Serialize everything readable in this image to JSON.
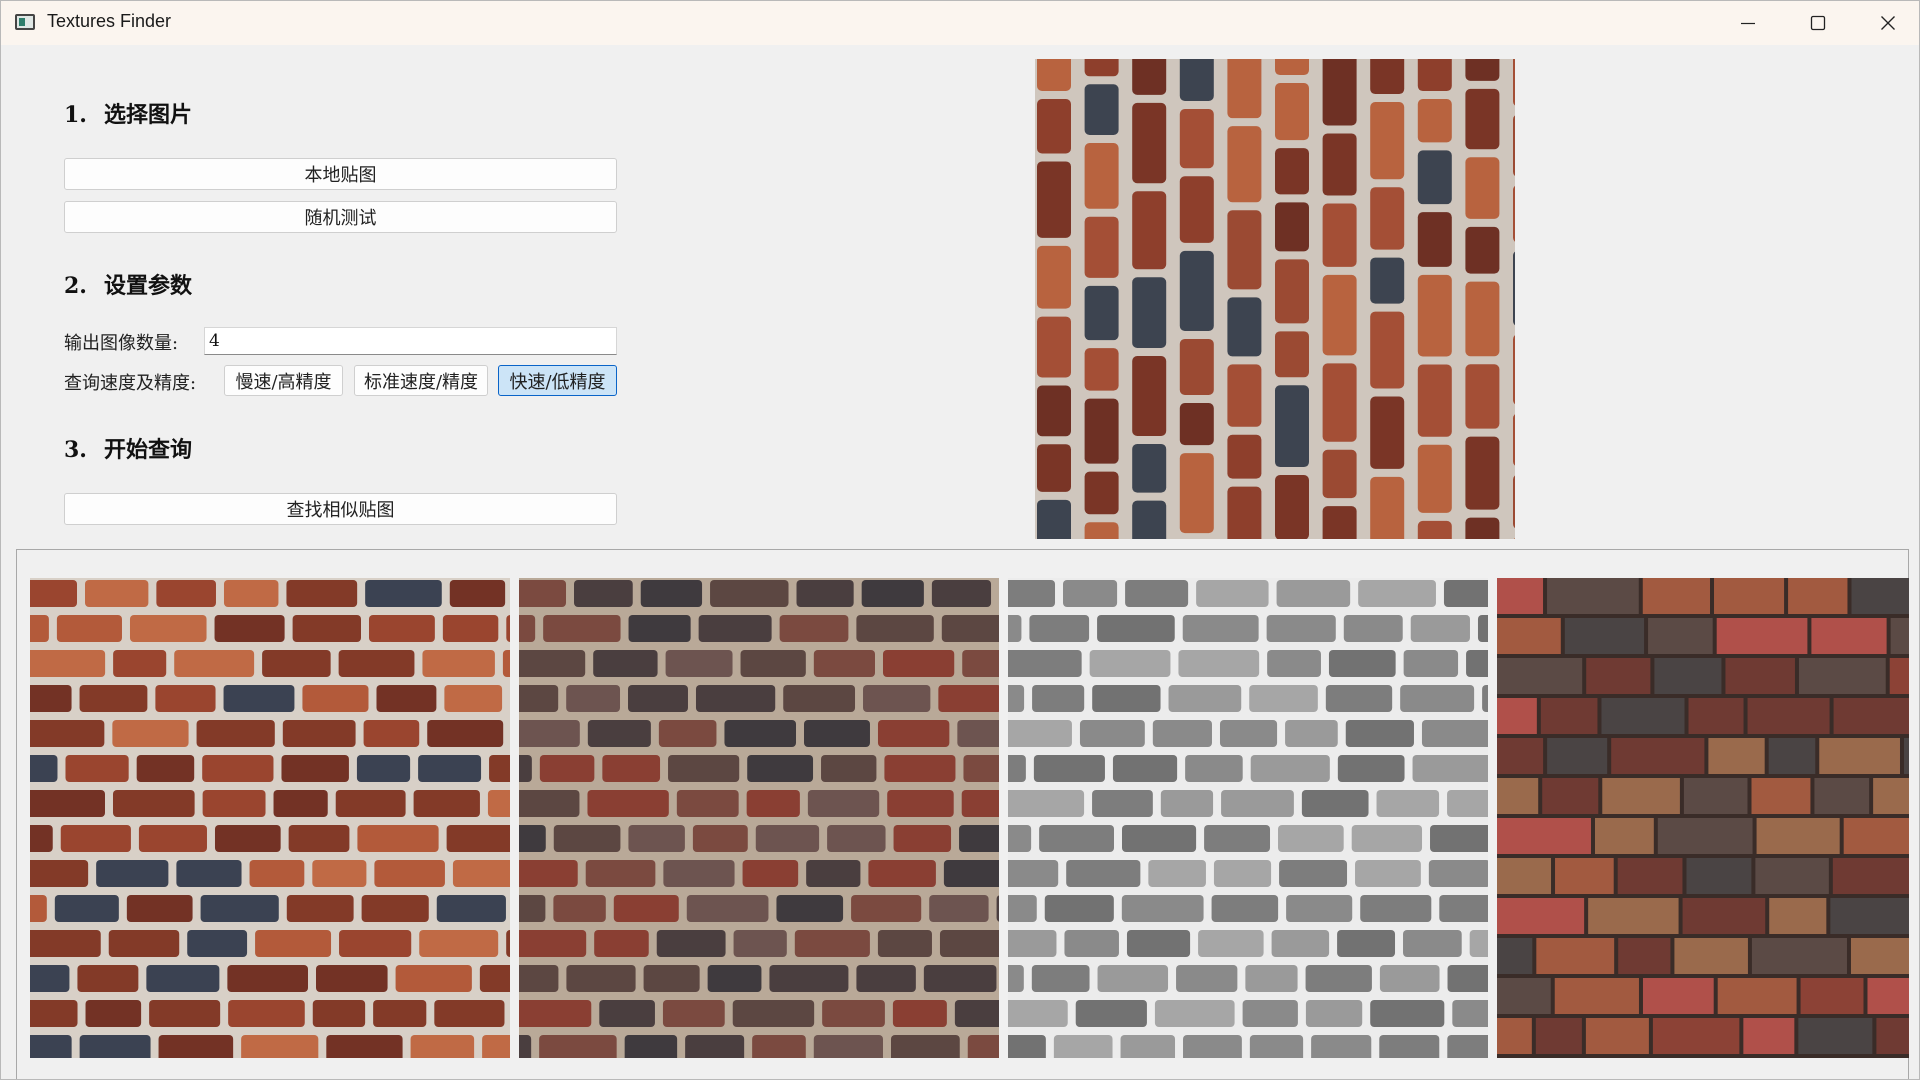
{
  "window": {
    "title": "Textures Finder",
    "controls": {
      "minimize": "minimize-icon",
      "maximize": "maximize-icon",
      "close": "close-icon"
    }
  },
  "step1": {
    "number": "1.",
    "title": "选择图片",
    "local_button": "本地贴图",
    "random_button": "随机测试"
  },
  "step2": {
    "number": "2.",
    "title": "设置参数",
    "count_label": "输出图像数量:",
    "count_value": "4",
    "speed_label": "查询速度及精度:",
    "speed_options": [
      "慢速/高精度",
      "标准速度/精度",
      "快速/低精度"
    ],
    "speed_selected": "快速/低精度"
  },
  "step3": {
    "number": "3.",
    "title": "开始查询",
    "find_button": "查找相似贴图"
  },
  "textures": {
    "query": {
      "kind": "brick-vertical",
      "mortar": "#cfc6bd",
      "palette": [
        "#8e3f2c",
        "#a44f36",
        "#7a3526",
        "#b8633f",
        "#6e3024",
        "#3d4450",
        "#9b4a33"
      ]
    },
    "results": [
      {
        "kind": "brick-horizontal",
        "mortar": "#d8d0c7",
        "palette": [
          "#9a452f",
          "#b35a3a",
          "#833a28",
          "#c06a45",
          "#733225",
          "#3b4252"
        ]
      },
      {
        "kind": "brick-horizontal",
        "mortar": "#b9a998",
        "palette": [
          "#5c4742",
          "#7b4a40",
          "#4a3e3f",
          "#8a3f33",
          "#3f3a3e",
          "#6d5450"
        ]
      },
      {
        "kind": "brick-horizontal",
        "mortar": "#ececec",
        "palette": [
          "#8a8a8a",
          "#9a9a9a",
          "#7d7d7d",
          "#a6a6a6",
          "#727272"
        ]
      },
      {
        "kind": "tile-stack",
        "mortar": "#3a2c28",
        "palette": [
          "#8c4236",
          "#a25a40",
          "#6f3a33",
          "#4a4444",
          "#9a6a4c",
          "#b0504a",
          "#5b4a45"
        ]
      }
    ]
  }
}
